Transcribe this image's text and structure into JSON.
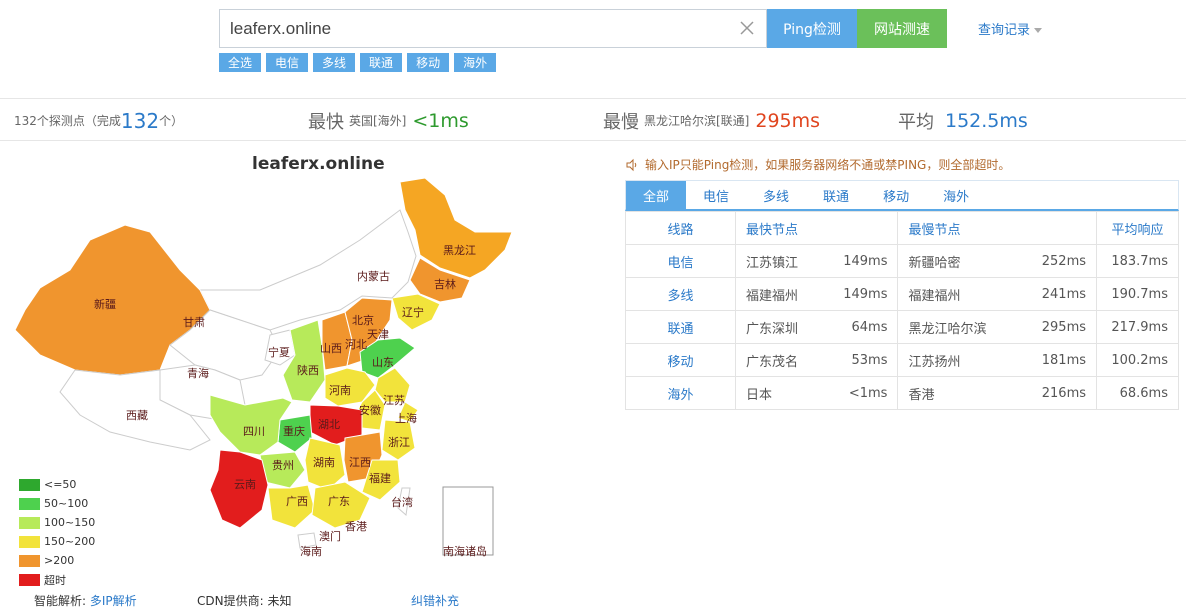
{
  "search": {
    "value": "leaferx.online"
  },
  "buttons": {
    "ping": "Ping检测",
    "speed": "网站测速",
    "history": "查询记录"
  },
  "filters": [
    "全选",
    "电信",
    "多线",
    "联通",
    "移动",
    "海外"
  ],
  "summary": {
    "probe_text": "132个探测点（完成",
    "probe_done": "132",
    "probe_unit": "个）",
    "fastest_label": "最快",
    "fastest_node": "英国[海外]",
    "fastest_value": "<1ms",
    "slowest_label": "最慢",
    "slowest_node": "黑龙江哈尔滨[联通]",
    "slowest_value": "295ms",
    "avg_label": "平均",
    "avg_value": "152.5ms"
  },
  "map": {
    "title": "leaferx.online",
    "legend": [
      {
        "label": "<=50",
        "color": "#2ea82e"
      },
      {
        "label": "50~100",
        "color": "#4ed14e"
      },
      {
        "label": "100~150",
        "color": "#b7ea5a"
      },
      {
        "label": "150~200",
        "color": "#f2e33b"
      },
      {
        "label": ">200",
        "color": "#f0952e"
      },
      {
        "label": "超时",
        "color": "#e21d1d"
      }
    ],
    "provinces": [
      "黑龙江",
      "吉林",
      "辽宁",
      "内蒙古",
      "新疆",
      "甘肃",
      "宁夏",
      "北京",
      "天津",
      "河北",
      "山西",
      "山东",
      "陕西",
      "河南",
      "青海",
      "西藏",
      "江苏",
      "安徽",
      "上海",
      "四川",
      "重庆",
      "湖北",
      "浙江",
      "贵州",
      "湖南",
      "江西",
      "福建",
      "云南",
      "广西",
      "广东",
      "台湾",
      "香港",
      "澳门",
      "海南",
      "南海诸岛"
    ]
  },
  "footer": {
    "dns_label": "智能解析:",
    "dns_link": "多IP解析",
    "cdn": "CDN提供商: 未知",
    "fix": "纠错补充"
  },
  "notice": "输入IP只能Ping检测，如果服务器网络不通或禁PING，则全部超时。",
  "tabs": [
    "全部",
    "电信",
    "多线",
    "联通",
    "移动",
    "海外"
  ],
  "table": {
    "headers": {
      "line": "线路",
      "fast": "最快节点",
      "slow": "最慢节点",
      "avg": "平均响应"
    },
    "rows": [
      {
        "line": "电信",
        "fast_node": "江苏镇江",
        "fast_ms": "149ms",
        "slow_node": "新疆哈密",
        "slow_ms": "252ms",
        "avg": "183.7ms"
      },
      {
        "line": "多线",
        "fast_node": "福建福州",
        "fast_ms": "149ms",
        "slow_node": "福建福州",
        "slow_ms": "241ms",
        "avg": "190.7ms"
      },
      {
        "line": "联通",
        "fast_node": "广东深圳",
        "fast_ms": "64ms",
        "slow_node": "黑龙江哈尔滨",
        "slow_ms": "295ms",
        "avg": "217.9ms"
      },
      {
        "line": "移动",
        "fast_node": "广东茂名",
        "fast_ms": "53ms",
        "slow_node": "江苏扬州",
        "slow_ms": "181ms",
        "avg": "100.2ms"
      },
      {
        "line": "海外",
        "fast_node": "日本",
        "fast_ms": "<1ms",
        "slow_node": "香港",
        "slow_ms": "216ms",
        "avg": "68.6ms"
      }
    ]
  }
}
